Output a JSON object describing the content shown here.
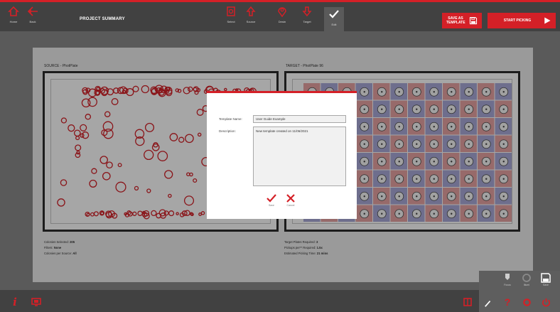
{
  "header": {
    "title": "PROJECT SUMMARY",
    "left_buttons": [
      {
        "label": "Home",
        "icon": "home-icon"
      },
      {
        "label": "Back",
        "icon": "back-arrow-icon"
      }
    ],
    "tools": [
      {
        "label": "Select",
        "icon": "select-icon"
      },
      {
        "label": "Source",
        "icon": "up-arrow-icon"
      },
      {
        "label": "Destn",
        "icon": "pin-icon"
      },
      {
        "label": "Target",
        "icon": "down-arrow-icon"
      },
      {
        "label": "Edit",
        "icon": "checkmark-icon"
      }
    ],
    "save_template_label": "SAVE AS TEMPLATE",
    "start_label": "START PICKING"
  },
  "source": {
    "label": "SOURCE - PhotPlate",
    "info": [
      {
        "key": "Colonies Selected:",
        "value": "205"
      },
      {
        "key": "Filters:",
        "value": "None"
      },
      {
        "key": "Colonies per Source:",
        "value": "All"
      }
    ]
  },
  "target": {
    "label": "TARGET - PhotPlate 96",
    "info": [
      {
        "key": "Target Plates Required:",
        "value": "3"
      },
      {
        "key": "Pickups per** Required:",
        "value": "1.5x"
      },
      {
        "key": "Estimated Picking Time:",
        "value": "21 mins"
      }
    ]
  },
  "dialog": {
    "name_label": "Template Name:",
    "name_value": "User Guide Example",
    "description_label": "Description:",
    "description_value": "New template created on 11/06/2021",
    "save_label": "Save",
    "cancel_label": "Cancel"
  },
  "bottom_right": [
    {
      "label": "Focus",
      "icon": "focus-icon"
    },
    {
      "label": "Illumi",
      "icon": "illumination-icon"
    },
    {
      "label": "Save",
      "icon": "save-icon"
    }
  ],
  "colors": {
    "brand_red": "#d42027",
    "bar_dark": "#414141"
  }
}
